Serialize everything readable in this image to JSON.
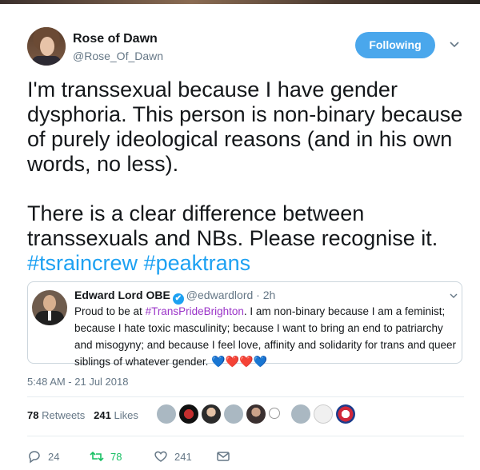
{
  "tweet": {
    "author": {
      "name": "Rose of Dawn",
      "handle": "@Rose_Of_Dawn"
    },
    "follow_label": "Following",
    "text": "I'm transsexual because I have gender dysphoria. This person is non-binary because of purely ideological reasons (and in his own words, no less).\n\nThere is a clear difference between transsexuals and NBs. Please recognise it.",
    "hashtags": [
      "#tsraincrew",
      "#peaktrans"
    ],
    "timestamp": "5:48 AM - 21 Jul 2018"
  },
  "quote": {
    "author": {
      "name": "Edward Lord OBE",
      "verified_icon": "✔",
      "handle": "@edwardlord · 2h"
    },
    "text_before": "Proud to be at ",
    "hashtag": "#TransPrideBrighton",
    "text_after": ". I am non-binary because I am a feminist; because I hate toxic masculinity; because I want to bring an end to patriarchy and misogyny; and because I feel love, affinity and solidarity for trans and queer siblings of whatever gender.",
    "emoji": [
      "💙",
      "❤️",
      "❤️",
      "💙"
    ]
  },
  "stats": {
    "retweets_count": "78",
    "retweets_label": "Retweets",
    "likes_count": "241",
    "likes_label": "Likes"
  },
  "actions": {
    "replies": "24",
    "retweets": "78",
    "likes": "241"
  },
  "colors": {
    "accent": "#1da1f2",
    "follow_button": "#4aa7ec",
    "retweet_green": "#17bf63",
    "muted": "#657786"
  }
}
